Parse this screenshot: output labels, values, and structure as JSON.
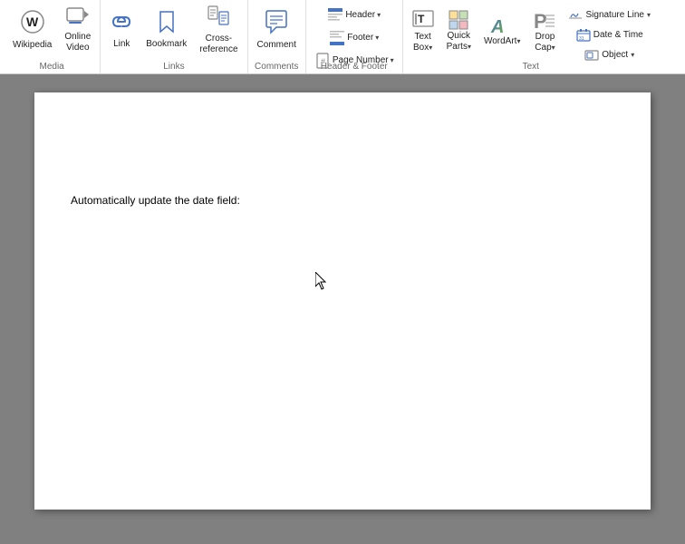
{
  "ribbon": {
    "groups": [
      {
        "name": "media",
        "label": "Media",
        "buttons": [
          {
            "id": "wikipedia",
            "icon": "🌐",
            "label": "Wikipedia",
            "large": true
          },
          {
            "id": "online-video",
            "icon": "🎬",
            "label": "Online\nVideo",
            "large": true
          }
        ]
      },
      {
        "name": "links",
        "label": "Links",
        "buttons": [
          {
            "id": "link",
            "icon": "🔗",
            "label": "Link",
            "large": true
          },
          {
            "id": "bookmark",
            "icon": "🔖",
            "label": "Bookmark",
            "large": true
          },
          {
            "id": "cross-reference",
            "icon": "📎",
            "label": "Cross-\nreference",
            "large": true
          }
        ]
      },
      {
        "name": "comments",
        "label": "Comments",
        "buttons": [
          {
            "id": "comment",
            "icon": "💬",
            "label": "Comment",
            "large": true
          }
        ]
      },
      {
        "name": "header-footer",
        "label": "Header & Footer",
        "buttons": [
          {
            "id": "header",
            "icon": "⬆",
            "label": "Header",
            "large": false,
            "dropdown": true
          },
          {
            "id": "footer",
            "icon": "⬇",
            "label": "Footer",
            "large": false,
            "dropdown": true
          },
          {
            "id": "page-number",
            "icon": "#",
            "label": "Page\nNumber",
            "large": false,
            "dropdown": true
          }
        ]
      },
      {
        "name": "text",
        "label": "Text",
        "buttons": [
          {
            "id": "text-box",
            "icon": "T",
            "label": "Text\nBox",
            "large": false,
            "dropdown": true
          },
          {
            "id": "quick-parts",
            "icon": "⚡",
            "label": "Quick\nParts",
            "large": false,
            "dropdown": true
          },
          {
            "id": "wordart",
            "icon": "A",
            "label": "WordArt",
            "large": false,
            "dropdown": true
          },
          {
            "id": "drop-cap",
            "icon": "P",
            "label": "Drop\nCap",
            "large": false,
            "dropdown": true
          }
        ],
        "right_buttons": [
          {
            "id": "signature-line",
            "icon": "✏",
            "label": "Signature Line",
            "dropdown": true
          },
          {
            "id": "date-time",
            "icon": "📅",
            "label": "Date & Time"
          },
          {
            "id": "object",
            "icon": "⬜",
            "label": "Object",
            "dropdown": true
          }
        ]
      }
    ]
  },
  "document": {
    "content": "Automatically update the date field:"
  }
}
